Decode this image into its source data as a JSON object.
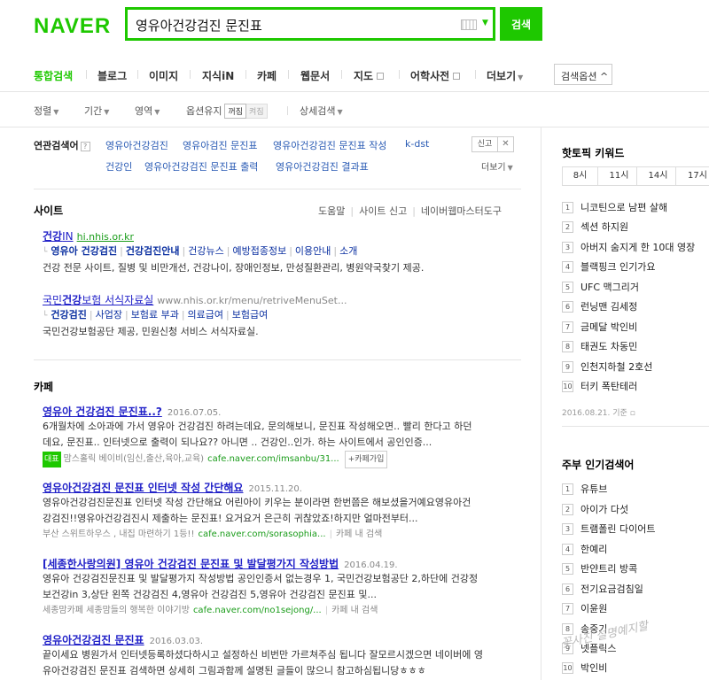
{
  "header": {
    "logo": "NAVER",
    "query": "영유아건강검진 문진표",
    "search_button": "검색"
  },
  "tabs": [
    "통합검색",
    "블로그",
    "이미지",
    "지식iN",
    "카페",
    "웹문서",
    "지도",
    "어학사전",
    "더보기"
  ],
  "search_options": "검색옵션",
  "filters": {
    "sort": "정렬",
    "period": "기간",
    "area": "영역",
    "keep_option": "옵션유지",
    "on": "꺼짐",
    "off": "켜짐",
    "detail": "상세검색"
  },
  "related": {
    "title": "연관검색어",
    "help": "?",
    "items": [
      "영유아건강검진",
      "영유아검진 문진표",
      "영유아건강검진 문진표 작성",
      "k-dst",
      "건강인",
      "영유아건강검진 문진표 출력",
      "영유아건강검진 결과표"
    ],
    "report": "신고",
    "close": "✕",
    "more": "더보기"
  },
  "site": {
    "title": "사이트",
    "links": [
      "도움말",
      "사이트 신고",
      "네이버웹마스터도구"
    ],
    "results": [
      {
        "title_bold": "건강",
        "title_rest": "IN",
        "url": "hi.nhis.or.kr",
        "sublinks": [
          "영유아 건강검진",
          "건강검진안내",
          "건강뉴스",
          "예방접종정보",
          "이용안내",
          "소개"
        ],
        "desc": "건강 전문 사이트, 질병 및 비만개선, 건강나이, 장애인정보, 만성질환관리, 병원약국찾기 제공."
      },
      {
        "title_pre": "국민",
        "title_bold": "건강",
        "title_rest": "보험 서식자료실",
        "url": "www.nhis.or.kr/menu/retriveMenuSet...",
        "sublinks": [
          "건강검진",
          "사업장",
          "보험료 부과",
          "의료급여",
          "보험급여"
        ],
        "desc": "국민건강보험공단 제공, 민원신청 서비스 서식자료실."
      }
    ]
  },
  "cafe": {
    "title": "카페",
    "results": [
      {
        "title": "영유아 건강검진 문진표..?",
        "date": "2016.07.05.",
        "line1": "6개월차에 소아과에 가서 영유아 건강검진 하려는데요, 문의해보니, 문진표 작성해오면.. 빨리 한다고 하던",
        "line2": "데요, 문진표.. 인터넷으로 출력이 되나요?? 아니면 .. 건강인..인가. 하는 사이트에서 공인인증...",
        "badge": "대표",
        "cafe_name": "맘스홀릭 베이비(임신,출산,육아,교육)",
        "cafe_url": "cafe.naver.com/imsanbu/31...",
        "join": "+카페가입"
      },
      {
        "title": "영유아건강검진 문진표 인터넷 작성 간단해요",
        "date": "2015.11.20.",
        "line1": "영유아건강검진문진표 인터넷 작성 간단해요 어린아이 키우는 분이라면 한번쯤은 해보셨을거예요영유아건",
        "line2": "강검진!!영유아건강검진시 제출하는 문진표! 요거요거 은근히 귀찮았죠!하지만 얼마전부터...",
        "cafe_name": "부산 스위트하우스 , 내집 마련하기 1등!!",
        "cafe_url": "cafe.naver.com/sorasophia...",
        "cafe_search": "카페 내 검색"
      },
      {
        "title": "[세종한사랑의원] 영유아 건강검진 문진표 및 발달평가지 작성방법",
        "date": "2016.04.19.",
        "line1": "영유아 건강검진문진표 및 발달평가지 작성방법 공인인증서 없는경우 1, 국민건강보험공단 2,하단에 건강정",
        "line2": "보건강in 3,상단 왼쪽 건강검진 4,영유아 건강검진 5,영유아 건강검진 문진표 및...",
        "cafe_name": "세종맘카페 세종맘들의 행복한 이야기방",
        "cafe_url": "cafe.naver.com/no1sejong/...",
        "cafe_search": "카페 내 검색"
      },
      {
        "title": "영유아건강검진 문진표",
        "date": "2016.03.03.",
        "line1": "끝이세요 병원가서 인터넷등록하셨다하시고 설정하신 비번만 가르쳐주심 됩니다 잘모르시겠으면 네이버에 영",
        "line2": "유아건강검진 문진표 검색하면 상세히 그림과함께 설명된 글들이 많으니 참고하심됩니당ㅎㅎㅎ"
      }
    ]
  },
  "sidebar": {
    "hot_title": "핫토픽 키워드",
    "time_tabs": [
      "8시",
      "11시",
      "14시",
      "17시"
    ],
    "hot_items": [
      "니코틴으로 남편 살해",
      "섹션 하지원",
      "아버지 숨지게 한 10대 영장",
      "블랙핑크 인기가요",
      "UFC 맥그리거",
      "런닝맨 김세정",
      "금메달 박인비",
      "태권도 차동민",
      "인천지하철 2호선",
      "터키 폭탄테러"
    ],
    "hot_date": "2016.08.21. 기준",
    "housewife_title": "주부 인기검색어",
    "housewife_items": [
      "유튜브",
      "아이가 다섯",
      "트램폴린 다이어트",
      "한예리",
      "반얀트리 방콕",
      "전기요금검침일",
      "이윤원",
      "송중기",
      "넷플릭스",
      "박인비"
    ]
  },
  "watermark": "꽃사진 설명예지할"
}
